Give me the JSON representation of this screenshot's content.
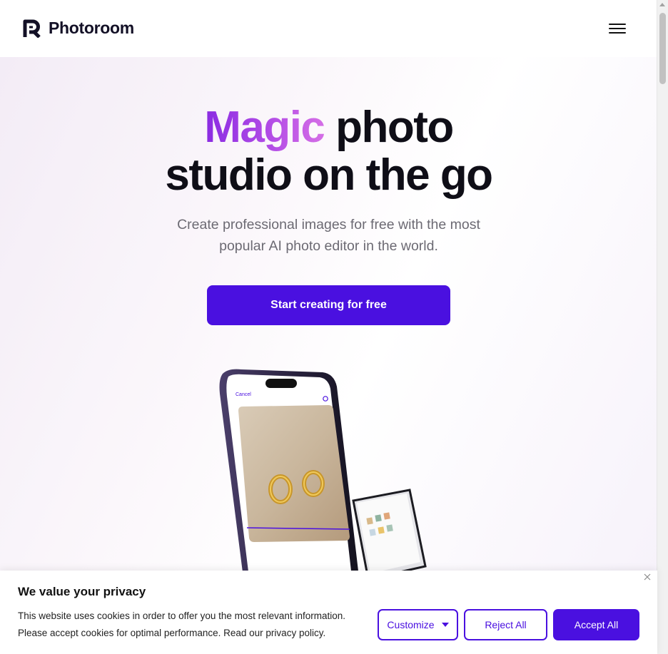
{
  "header": {
    "brand": "Photoroom",
    "menu_icon": "hamburger-menu-icon"
  },
  "hero": {
    "title_highlight": "Magic",
    "title_rest_line1": "photo",
    "title_line2": "studio on the go",
    "subtitle_line1": "Create professional images for free with the most",
    "subtitle_line2": "popular AI photo editor in the world.",
    "cta_label": "Start creating for free",
    "phone_cancel_label": "Cancel"
  },
  "cookie_banner": {
    "title": "We value your privacy",
    "text_line1": "This website uses cookies in order to offer you the most relevant information.",
    "text_line2": "Please accept cookies for optimal performance. Read our privacy policy.",
    "customize_label": "Customize",
    "reject_label": "Reject All",
    "accept_label": "Accept All"
  },
  "colors": {
    "accent": "#4a10e0",
    "magic_gradient_start": "#8a2be2",
    "magic_gradient_end": "#d56ee6"
  }
}
